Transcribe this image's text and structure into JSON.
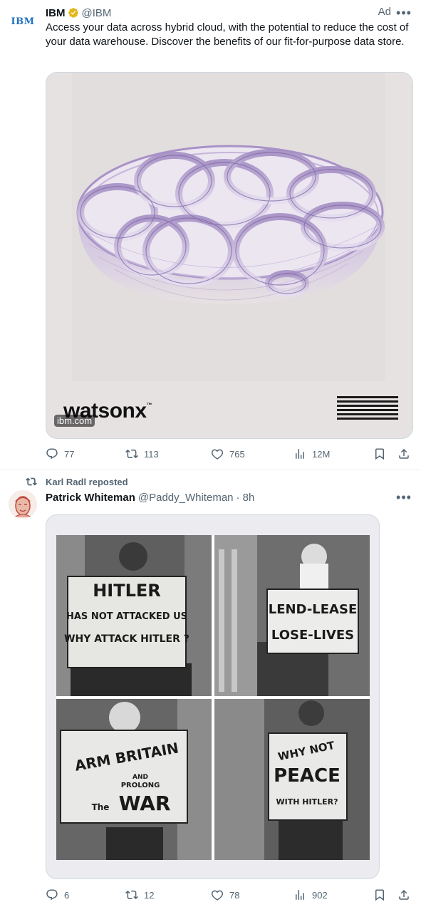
{
  "post1": {
    "name": "IBM",
    "handle": "@IBM",
    "ad_label": "Ad",
    "avatar_text": "IBM",
    "text": "Access your data across hybrid cloud, with the potential to reduce the cost of your data warehouse. Discover the benefits of our fit-for-purpose data store.",
    "media": {
      "product_logo": "watsonx",
      "brand_logo": "IBM",
      "link_domain": "ibm.com"
    },
    "actions": {
      "replies": "77",
      "reposts": "113",
      "likes": "765",
      "views": "12M"
    }
  },
  "post2": {
    "repost_by": "Karl Radl reposted",
    "name": "Patrick Whiteman",
    "handle": "@Paddy_Whiteman",
    "time": "· 8h",
    "signs": {
      "top_left": [
        "HITLER",
        "HAS NOT ATTACKED US",
        "WHY ATTACK HITLER ?"
      ],
      "top_right": [
        "LEND-LEASE",
        "LOSE-LIVES"
      ],
      "bottom_left": [
        "ARM BRITAIN",
        "AND",
        "PROLONG",
        "The",
        "WAR"
      ],
      "bottom_right": [
        "WHY NOT",
        "PEACE",
        "WITH HITLER?"
      ]
    },
    "actions": {
      "replies": "6",
      "reposts": "12",
      "likes": "78",
      "views": "902"
    }
  },
  "colors": {
    "accent": "#1d9bf0",
    "muted": "#536471",
    "verified": "#e2b719",
    "text": "#0f1419"
  },
  "icons": [
    "verified-badge-icon",
    "more-icon",
    "reply-icon",
    "repost-icon",
    "like-icon",
    "views-icon",
    "bookmark-icon",
    "share-icon"
  ]
}
